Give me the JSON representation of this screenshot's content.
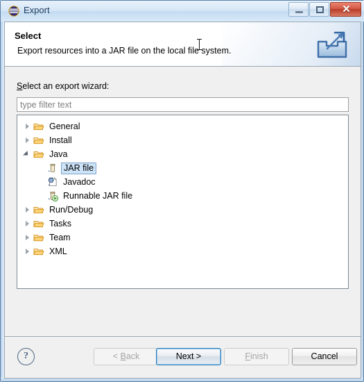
{
  "window": {
    "title": "Export",
    "icon": "eclipse-icon",
    "controls": {
      "minimize_label": "",
      "maximize_label": "",
      "close_label": "✕"
    }
  },
  "header": {
    "title": "Select",
    "description": "Export resources into a JAR file on the local file system.",
    "icon": "export-wizard-icon"
  },
  "body": {
    "wizard_label_prefix": "S",
    "wizard_label_rest": "elect an export wizard:",
    "filter": {
      "value": "",
      "placeholder": "type filter text"
    },
    "tree": [
      {
        "label": "General",
        "level": 0,
        "state": "collapsed",
        "icon": "folder-icon",
        "selected": false
      },
      {
        "label": "Install",
        "level": 0,
        "state": "collapsed",
        "icon": "folder-icon",
        "selected": false
      },
      {
        "label": "Java",
        "level": 0,
        "state": "expanded",
        "icon": "folder-icon",
        "selected": false
      },
      {
        "label": "JAR file",
        "level": 1,
        "state": "leaf",
        "icon": "jar-icon",
        "selected": true
      },
      {
        "label": "Javadoc",
        "level": 1,
        "state": "leaf",
        "icon": "javadoc-icon",
        "selected": false
      },
      {
        "label": "Runnable JAR file",
        "level": 1,
        "state": "leaf",
        "icon": "runnable-jar-icon",
        "selected": false
      },
      {
        "label": "Run/Debug",
        "level": 0,
        "state": "collapsed",
        "icon": "folder-icon",
        "selected": false
      },
      {
        "label": "Tasks",
        "level": 0,
        "state": "collapsed",
        "icon": "folder-icon",
        "selected": false
      },
      {
        "label": "Team",
        "level": 0,
        "state": "collapsed",
        "icon": "folder-icon",
        "selected": false
      },
      {
        "label": "XML",
        "level": 0,
        "state": "collapsed",
        "icon": "folder-icon",
        "selected": false
      }
    ]
  },
  "buttons": {
    "help": "?",
    "back": {
      "label_prefix": "< ",
      "label_mnemonic": "B",
      "label_rest": "ack",
      "enabled": false,
      "default": false
    },
    "next": {
      "label_prefix": "",
      "label_mnemonic": "N",
      "label_rest": "ext >",
      "enabled": true,
      "default": true
    },
    "finish": {
      "label_prefix": "",
      "label_mnemonic": "F",
      "label_rest": "inish",
      "enabled": false,
      "default": false
    },
    "cancel": {
      "label_prefix": "",
      "label_mnemonic": "C",
      "label_rest": "ancel",
      "enabled": true,
      "default": false
    }
  },
  "colors": {
    "selection_fill": "#cde3f7",
    "selection_border": "#7da2cc",
    "folder": "#f0b429",
    "close_button": "#b93c28",
    "default_button_focus": "#2f7ebb"
  }
}
